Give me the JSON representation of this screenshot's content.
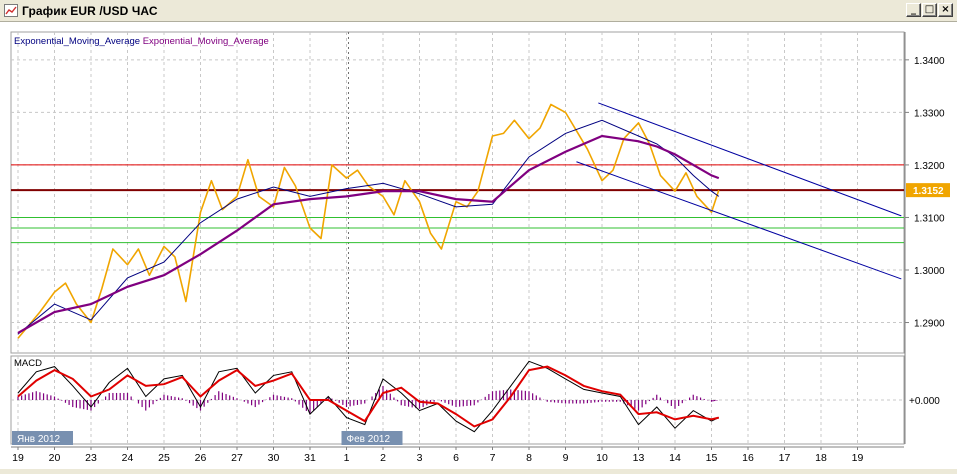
{
  "window": {
    "title": "График EUR /USD ЧАС",
    "minimize_glyph": "_",
    "maximize_glyph": "□",
    "close_glyph": "×"
  },
  "colors": {
    "price": "#f0a500",
    "ema_fast": "#000080",
    "ema_slow": "#800080",
    "macd_line": "#000000",
    "macd_signal": "#e00000",
    "macd_hist": "#800080",
    "channel": "#0000a0",
    "level_red": "#e00000",
    "level_dark": "#800000",
    "level_green": "#30c030",
    "current_price_badge": "#f0a500",
    "date_badge": "#7890b0",
    "grid": "#c8c8c8"
  },
  "chart_data": [
    {
      "type": "line",
      "title": "График EUR /USD ЧАС",
      "legend": [
        "Exponential_Moving_Average",
        "Exponential_Moving_Average"
      ],
      "x_tick_labels": [
        "19",
        "20",
        "23",
        "24",
        "25",
        "26",
        "27",
        "30",
        "31",
        "1",
        "2",
        "3",
        "6",
        "7",
        "8",
        "9",
        "10",
        "13",
        "14",
        "15",
        "16",
        "17",
        "18",
        "19"
      ],
      "date_markers": [
        {
          "label": "Янв 2012",
          "x": 0
        },
        {
          "label": "Фев 2012",
          "x": 9
        }
      ],
      "ylim": [
        1.2842,
        1.3453
      ],
      "y_ticks": [
        1.29,
        1.3,
        1.31,
        1.32,
        1.33,
        1.34
      ],
      "y_tick_labels": [
        "1.2900",
        "1.3000",
        "1.3100",
        "1.3200",
        "1.3300",
        "1.3400"
      ],
      "current_price": "1.3152",
      "grid": true,
      "horizontal_levels": [
        {
          "value": 1.32,
          "color": "red"
        },
        {
          "value": 1.3152,
          "color": "dark-red"
        },
        {
          "value": 1.31,
          "color": "green"
        },
        {
          "value": 1.308,
          "color": "green"
        },
        {
          "value": 1.3052,
          "color": "green"
        }
      ],
      "series": [
        {
          "role": "price",
          "x": [
            0.0,
            0.3,
            0.6,
            1.0,
            1.3,
            1.6,
            2.0,
            2.3,
            2.6,
            3.0,
            3.3,
            3.6,
            4.0,
            4.3,
            4.6,
            5.0,
            5.3,
            5.6,
            6.0,
            6.3,
            6.6,
            7.0,
            7.3,
            7.6,
            8.0,
            8.3,
            8.6,
            9.0,
            9.3,
            9.6,
            10.0,
            10.3,
            10.6,
            11.0,
            11.3,
            11.6,
            12.0,
            12.3,
            12.6,
            13.0,
            13.3,
            13.6,
            14.0,
            14.3,
            14.6,
            15.0,
            15.3,
            15.6,
            16.0,
            16.3,
            16.6,
            17.0,
            17.3,
            17.6,
            18.0,
            18.3,
            18.6,
            19.0,
            19.2
          ],
          "values": [
            1.287,
            1.2895,
            1.292,
            1.2958,
            1.2975,
            1.2935,
            1.29,
            1.2965,
            1.304,
            1.301,
            1.304,
            1.299,
            1.3045,
            1.3025,
            1.294,
            1.311,
            1.317,
            1.3115,
            1.314,
            1.321,
            1.314,
            1.312,
            1.3195,
            1.316,
            1.308,
            1.306,
            1.32,
            1.3175,
            1.319,
            1.316,
            1.314,
            1.3105,
            1.317,
            1.313,
            1.307,
            1.304,
            1.313,
            1.312,
            1.315,
            1.3255,
            1.326,
            1.3285,
            1.325,
            1.327,
            1.3315,
            1.33,
            1.3265,
            1.323,
            1.317,
            1.319,
            1.325,
            1.328,
            1.324,
            1.318,
            1.315,
            1.3185,
            1.314,
            1.311,
            1.3152
          ]
        },
        {
          "name": "Exponential_Moving_Average",
          "role": "ema_fast",
          "x": [
            0,
            1,
            2,
            3,
            4,
            5,
            6,
            7,
            8,
            9,
            10,
            11,
            12,
            13,
            14,
            15,
            16,
            17,
            17.5,
            18,
            18.5,
            19,
            19.2
          ],
          "values": [
            1.2878,
            1.2935,
            1.2905,
            1.2985,
            1.3015,
            1.309,
            1.3135,
            1.3158,
            1.314,
            1.3155,
            1.3165,
            1.3145,
            1.312,
            1.3125,
            1.3215,
            1.326,
            1.3285,
            1.3255,
            1.324,
            1.3215,
            1.318,
            1.315,
            1.314
          ]
        },
        {
          "name": "Exponential_Moving_Average",
          "role": "ema_slow",
          "x": [
            0,
            1,
            2,
            3,
            4,
            5,
            6,
            7,
            8,
            9,
            10,
            11,
            12,
            13,
            14,
            15,
            16,
            17,
            17.5,
            18,
            18.5,
            19,
            19.2
          ],
          "values": [
            1.288,
            1.292,
            1.2935,
            1.2968,
            1.299,
            1.303,
            1.3075,
            1.3125,
            1.3135,
            1.314,
            1.315,
            1.315,
            1.3135,
            1.313,
            1.319,
            1.3225,
            1.3255,
            1.3245,
            1.3235,
            1.322,
            1.32,
            1.318,
            1.3175
          ]
        },
        {
          "role": "channel_upper",
          "x": [
            15.9,
            24.2
          ],
          "values": [
            1.3318,
            1.3103
          ]
        },
        {
          "role": "channel_lower",
          "x": [
            15.3,
            24.2
          ],
          "values": [
            1.3206,
            1.2983
          ]
        }
      ]
    },
    {
      "type": "line",
      "title": "MACD",
      "ylim": [
        -1.25,
        1.25
      ],
      "y_ticks": [
        0
      ],
      "y_tick_labels": [
        "+0.000"
      ],
      "grid": true,
      "series": [
        {
          "role": "macd",
          "x": [
            0,
            0.5,
            1,
            1.5,
            2,
            2.5,
            3,
            3.5,
            4,
            4.5,
            5,
            5.5,
            6,
            6.5,
            7,
            7.5,
            8,
            8.5,
            9,
            9.5,
            10,
            10.5,
            11,
            11.5,
            12,
            12.5,
            13,
            13.5,
            14,
            14.5,
            15,
            15.5,
            16,
            16.5,
            17,
            17.5,
            18,
            18.5,
            19,
            19.2
          ],
          "values": [
            0.2,
            0.8,
            0.95,
            0.4,
            -0.2,
            0.5,
            0.9,
            0.1,
            0.6,
            0.7,
            -0.2,
            0.8,
            0.9,
            0.2,
            0.7,
            0.8,
            -0.4,
            0.1,
            -0.5,
            -0.7,
            0.6,
            0.2,
            -0.3,
            -0.1,
            -0.6,
            -0.9,
            -0.3,
            0.4,
            1.1,
            0.9,
            0.6,
            0.3,
            0.2,
            0.1,
            -0.7,
            -0.2,
            -0.8,
            -0.3,
            -0.6,
            -0.5
          ]
        },
        {
          "role": "signal",
          "x": [
            0,
            0.5,
            1,
            1.5,
            2,
            2.5,
            3,
            3.5,
            4,
            4.5,
            5,
            5.5,
            6,
            6.5,
            7,
            7.5,
            8,
            8.5,
            9,
            9.5,
            10,
            10.5,
            11,
            11.5,
            12,
            12.5,
            13,
            13.5,
            14,
            14.5,
            15,
            15.5,
            16,
            16.5,
            17,
            17.5,
            18,
            18.5,
            19,
            19.2
          ],
          "values": [
            0.1,
            0.55,
            0.85,
            0.6,
            0.1,
            0.3,
            0.7,
            0.4,
            0.45,
            0.65,
            0.1,
            0.55,
            0.85,
            0.4,
            0.55,
            0.75,
            0.0,
            0.0,
            -0.3,
            -0.6,
            0.2,
            0.35,
            -0.05,
            -0.1,
            -0.4,
            -0.75,
            -0.55,
            0.1,
            0.85,
            0.95,
            0.7,
            0.4,
            0.25,
            0.15,
            -0.4,
            -0.35,
            -0.55,
            -0.45,
            -0.55,
            -0.5
          ]
        },
        {
          "role": "histogram",
          "x": [
            0,
            0.5,
            1,
            1.5,
            2,
            2.5,
            3,
            3.5,
            4,
            4.5,
            5,
            5.5,
            6,
            6.5,
            7,
            7.5,
            8,
            8.5,
            9,
            9.5,
            10,
            10.5,
            11,
            11.5,
            12,
            12.5,
            13,
            13.5,
            14,
            14.5,
            15,
            15.5,
            16,
            16.5,
            17,
            17.5,
            18,
            18.5,
            19,
            19.2
          ],
          "values": [
            0.1,
            0.25,
            0.1,
            -0.2,
            -0.3,
            0.2,
            0.2,
            -0.3,
            0.15,
            0.05,
            -0.3,
            0.25,
            0.05,
            -0.2,
            0.15,
            0.05,
            -0.4,
            0.1,
            -0.2,
            -0.1,
            0.4,
            -0.15,
            -0.25,
            0.0,
            -0.2,
            -0.15,
            0.25,
            0.3,
            0.25,
            -0.05,
            -0.1,
            -0.1,
            -0.05,
            -0.05,
            -0.3,
            0.15,
            -0.25,
            0.15,
            -0.05,
            0.0
          ]
        }
      ]
    }
  ]
}
